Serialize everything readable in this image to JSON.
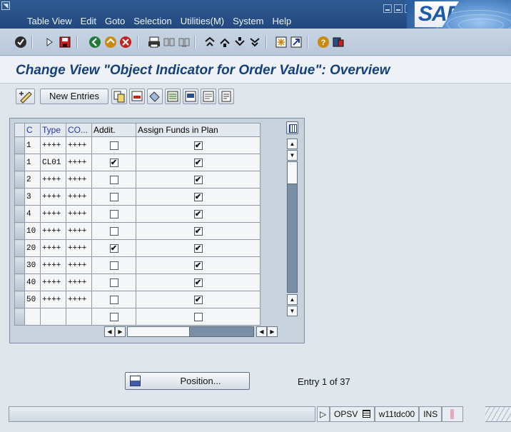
{
  "menubar": {
    "items": [
      "Table View",
      "Edit",
      "Goto",
      "Selection",
      "Utilities(M)",
      "System",
      "Help"
    ],
    "logo": "SAP"
  },
  "title": "Change View \"Object Indicator for Order Value\": Overview",
  "app_toolbar": {
    "new_entries": "New Entries"
  },
  "table": {
    "columns": [
      "C",
      "Type",
      "CO...",
      "Addit.",
      "Assign Funds in Plan"
    ],
    "rows": [
      {
        "c": "1",
        "type": "++++",
        "co": "++++",
        "addit": false,
        "assign": true
      },
      {
        "c": "1",
        "type": "CL01",
        "co": "++++",
        "addit": true,
        "assign": true
      },
      {
        "c": "2",
        "type": "++++",
        "co": "++++",
        "addit": false,
        "assign": true
      },
      {
        "c": "3",
        "type": "++++",
        "co": "++++",
        "addit": false,
        "assign": true
      },
      {
        "c": "4",
        "type": "++++",
        "co": "++++",
        "addit": false,
        "assign": true
      },
      {
        "c": "10",
        "type": "++++",
        "co": "++++",
        "addit": false,
        "assign": true
      },
      {
        "c": "20",
        "type": "++++",
        "co": "++++",
        "addit": true,
        "assign": true
      },
      {
        "c": "30",
        "type": "++++",
        "co": "++++",
        "addit": false,
        "assign": true
      },
      {
        "c": "40",
        "type": "++++",
        "co": "++++",
        "addit": false,
        "assign": true
      },
      {
        "c": "50",
        "type": "++++",
        "co": "++++",
        "addit": false,
        "assign": true
      },
      {
        "c": "",
        "type": "",
        "co": "",
        "addit": false,
        "assign": false
      }
    ]
  },
  "position_button": "Position...",
  "entry_info": "Entry 1 of 37",
  "statusbar": {
    "transaction": "OPSV",
    "server": "w11tdc00",
    "mode": "INS"
  }
}
